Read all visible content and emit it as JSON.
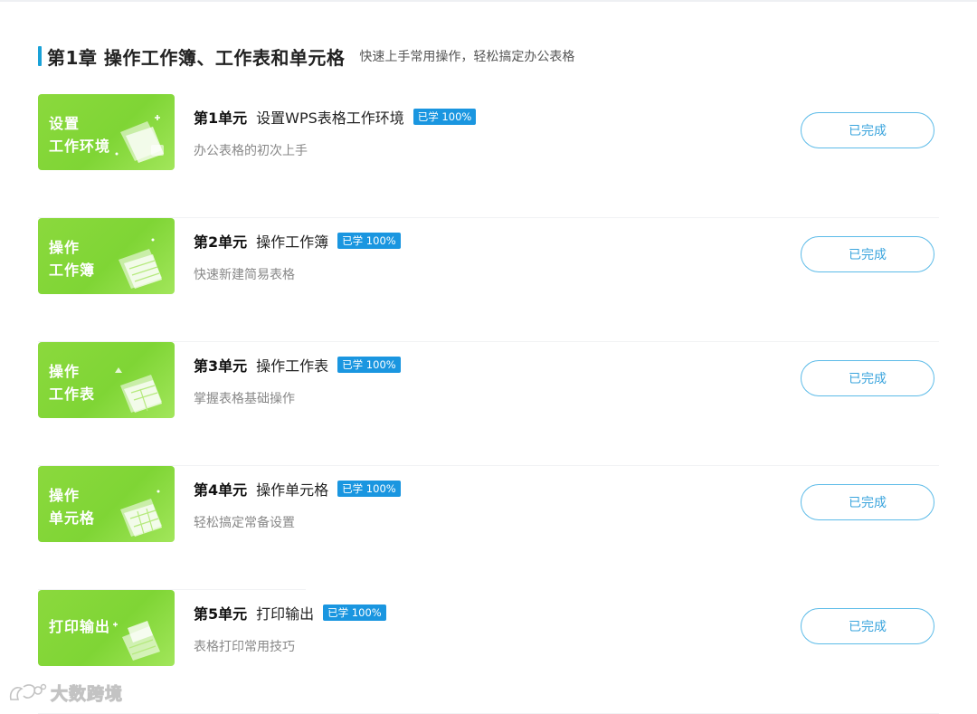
{
  "chapter": {
    "title": "第1章 操作工作簿、工作表和单元格",
    "subtitle": "快速上手常用操作，轻松搞定办公表格",
    "accent_color": "#1aa2d8"
  },
  "units": [
    {
      "thumb_lines": [
        "设置",
        "工作环境"
      ],
      "number": "第1单元",
      "name": "设置WPS表格工作环境",
      "progress": "已学 100%",
      "description": "办公表格的初次上手",
      "status": "已完成"
    },
    {
      "thumb_lines": [
        "操作",
        "工作簿"
      ],
      "number": "第2单元",
      "name": "操作工作簿",
      "progress": "已学 100%",
      "description": "快速新建简易表格",
      "status": "已完成"
    },
    {
      "thumb_lines": [
        "操作",
        "工作表"
      ],
      "number": "第3单元",
      "name": "操作工作表",
      "progress": "已学 100%",
      "description": "掌握表格基础操作",
      "status": "已完成"
    },
    {
      "thumb_lines": [
        "操作",
        "单元格"
      ],
      "number": "第4单元",
      "name": "操作单元格",
      "progress": "已学 100%",
      "description": "轻松搞定常备设置",
      "status": "已完成"
    },
    {
      "thumb_lines": [
        "打印输出",
        ""
      ],
      "number": "第5单元",
      "name": "打印输出",
      "progress": "已学 100%",
      "description": "表格打印常用技巧",
      "status": "已完成"
    }
  ],
  "watermark": {
    "text": "大数跨境"
  },
  "colors": {
    "thumb_green": "#84d638",
    "badge_blue": "#1a96e0",
    "button_border": "#5cbbe8"
  }
}
